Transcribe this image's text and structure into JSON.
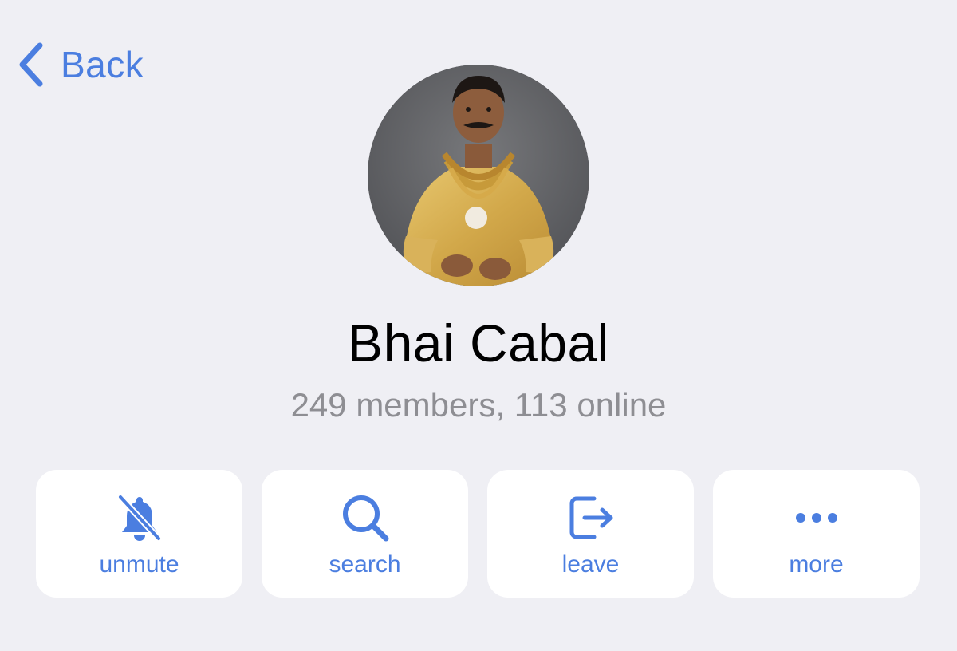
{
  "nav": {
    "back_label": "Back"
  },
  "profile": {
    "name": "Bhai Cabal",
    "status": "249 members, 113 online"
  },
  "actions": [
    {
      "label": "unmute",
      "icon": "bell-slash-icon"
    },
    {
      "label": "search",
      "icon": "magnifier-icon"
    },
    {
      "label": "leave",
      "icon": "exit-icon"
    },
    {
      "label": "more",
      "icon": "ellipsis-icon"
    }
  ],
  "colors": {
    "background": "#efeff4",
    "accent": "#4b7ee0",
    "secondary_text": "#8e8e93",
    "card": "#ffffff"
  }
}
